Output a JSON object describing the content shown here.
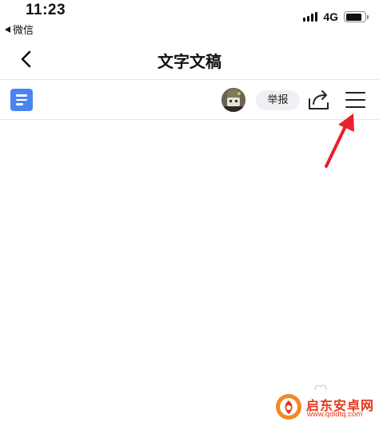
{
  "status_bar": {
    "time": "11:23",
    "back_app": "微信",
    "network": "4G",
    "battery_level": 0.85
  },
  "nav": {
    "title": "文字文稿",
    "back_icon": "chevron-left-icon"
  },
  "toolbar": {
    "doc_icon": "document-icon",
    "report_label": "举报",
    "share_icon": "share-icon",
    "menu_icon": "hamburger-menu-icon"
  },
  "annotation": {
    "color": "#e8202a",
    "icon": "arrow-icon"
  },
  "watermark": {
    "title": "启东安卓网",
    "url": "www.qdldtq.com",
    "color": "#e4371c"
  },
  "colors": {
    "doc_icon_blue": "#4a84f0",
    "divider": "#e6e6e6",
    "report_bg": "#eff0f3"
  }
}
